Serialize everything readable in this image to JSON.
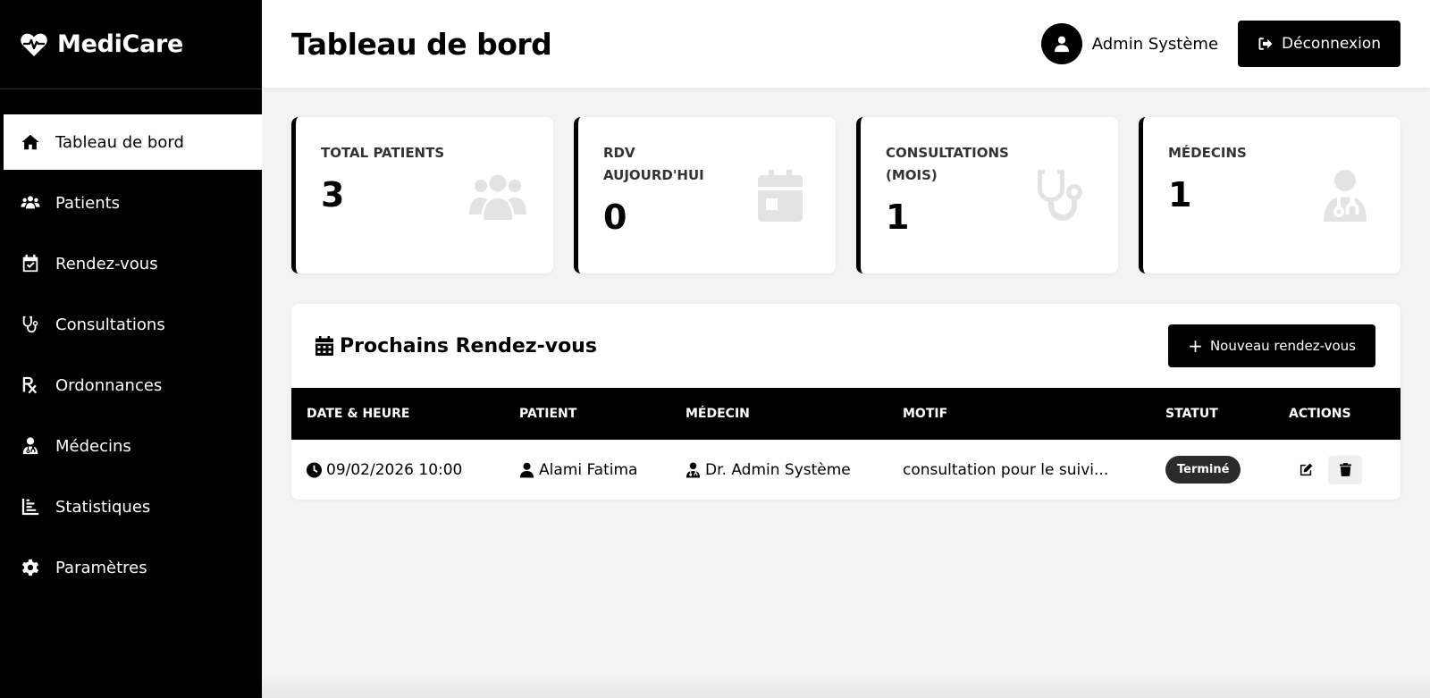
{
  "app": {
    "brand": "MediCare",
    "logo_icon": "heart-pulse-icon"
  },
  "sidebar": {
    "items": [
      {
        "label": "Tableau de bord",
        "icon": "home-icon",
        "active": true
      },
      {
        "label": "Patients",
        "icon": "users-icon"
      },
      {
        "label": "Rendez-vous",
        "icon": "calendar-check-icon"
      },
      {
        "label": "Consultations",
        "icon": "stethoscope-icon"
      },
      {
        "label": "Ordonnances",
        "icon": "prescription-icon"
      },
      {
        "label": "Médecins",
        "icon": "doctor-icon"
      },
      {
        "label": "Statistiques",
        "icon": "chart-icon"
      },
      {
        "label": "Paramètres",
        "icon": "gear-icon"
      }
    ]
  },
  "header": {
    "title": "Tableau de bord",
    "user_name": "Admin Système",
    "logout_label": "Déconnexion"
  },
  "stats": [
    {
      "label": "TOTAL PATIENTS",
      "value": "3",
      "icon": "users-icon"
    },
    {
      "label": "RDV AUJOURD'HUI",
      "value": "0",
      "icon": "calendar-icon"
    },
    {
      "label": "CONSULTATIONS (MOIS)",
      "value": "1",
      "icon": "stethoscope-icon"
    },
    {
      "label": "MÉDECINS",
      "value": "1",
      "icon": "doctor-icon"
    }
  ],
  "appointments": {
    "title": "Prochains Rendez-vous",
    "new_button_label": "Nouveau rendez-vous",
    "columns": [
      "DATE & HEURE",
      "PATIENT",
      "MÉDECIN",
      "MOTIF",
      "STATUT",
      "ACTIONS"
    ],
    "rows": [
      {
        "datetime": "09/02/2026 10:00",
        "patient": "Alami Fatima",
        "doctor": "Dr. Admin Système",
        "motif": "consultation pour le suivi...",
        "status": "Terminé"
      }
    ]
  },
  "colors": {
    "primary": "#000000",
    "background": "#f3f3f3",
    "card_icon": "#e3e3e3",
    "badge": "#2b2b2b"
  }
}
